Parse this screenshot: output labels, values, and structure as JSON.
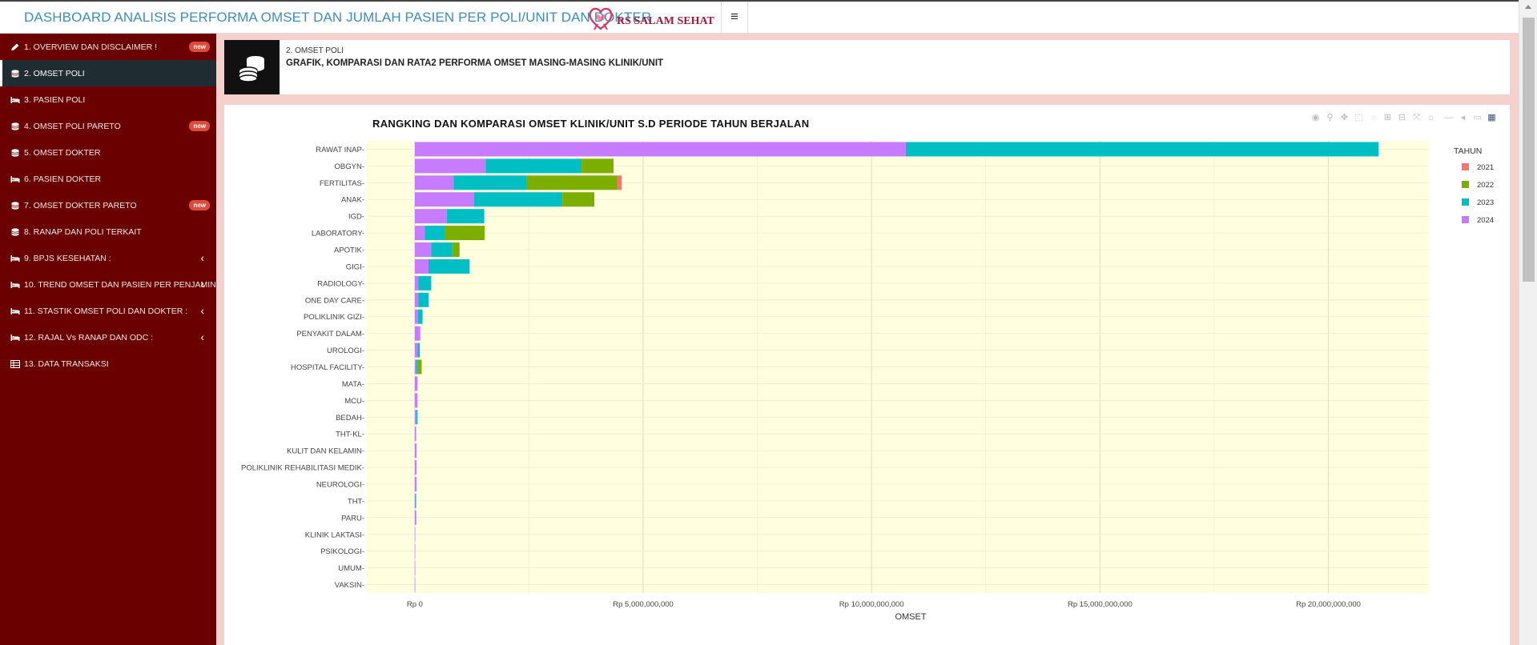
{
  "header": {
    "app_title": "DASHBOARD ANALISIS PERFORMA OMSET DAN JUMLAH PASIEN PER POLI/UNIT DAN DOKTER",
    "logo_text": "RS SALAM SEHAT",
    "menu_icon": "hamburger-icon"
  },
  "sidebar": {
    "items": [
      {
        "label": "1. OVERVIEW DAN DISCLAIMER !",
        "icon": "pencil-icon",
        "badge": "new"
      },
      {
        "label": "2. OMSET POLI",
        "icon": "database-icon",
        "active": true
      },
      {
        "label": "3. PASIEN POLI",
        "icon": "bed-icon"
      },
      {
        "label": "4. OMSET POLI PARETO",
        "icon": "database-icon",
        "badge": "new"
      },
      {
        "label": "5. OMSET DOKTER",
        "icon": "database-icon"
      },
      {
        "label": "6. PASIEN DOKTER",
        "icon": "bed-icon"
      },
      {
        "label": "7. OMSET DOKTER PARETO",
        "icon": "database-icon",
        "badge": "new"
      },
      {
        "label": "8. RANAP DAN POLI TERKAIT",
        "icon": "database-icon"
      },
      {
        "label": "9. BPJS KESEHATAN :",
        "icon": "bed-icon",
        "chevron": true
      },
      {
        "label": "10. TREND OMSET DAN PASIEN PER PENJAMIN :",
        "icon": "bed-icon",
        "chevron": true
      },
      {
        "label": "11. STASTIK OMSET POLI DAN DOKTER :",
        "icon": "bed-icon",
        "chevron": true
      },
      {
        "label": "12. RAJAL Vs RANAP DAN ODC :",
        "icon": "bed-icon",
        "chevron": true
      },
      {
        "label": "13. DATA TRANSAKSI",
        "icon": "table-icon"
      }
    ]
  },
  "page_header": {
    "subtitle": "2. OMSET POLI",
    "title": "GRAFIK, KOMPARASI DAN RATA2 PERFORMA OMSET MASING-MASING KLINIK/UNIT",
    "icon": "database-icon"
  },
  "modebar": [
    "camera-icon",
    "zoom-icon",
    "pan-icon",
    "box-select-icon",
    "lasso-icon",
    "zoom-in-icon",
    "zoom-out-icon",
    "autoscale-icon",
    "reset-axes-icon",
    "spike-lines-icon",
    "hover-closest-icon",
    "hover-compare-icon",
    "plotly-logo-icon"
  ],
  "colors": {
    "2021": "#F8766D",
    "2022": "#7CAE00",
    "2023": "#00BFC4",
    "2024": "#C77CFF",
    "plot_bg": "#FFFFE0",
    "sidebar_bg": "#6B0000"
  },
  "chart_data": {
    "type": "bar",
    "orientation": "horizontal",
    "stacked": true,
    "title": "RANGKING DAN KOMPARASI OMSET KLINIK/UNIT S.D PERIODE TAHUN BERJALAN",
    "xlabel": "OMSET",
    "ylabel": "",
    "xlim": [
      -1050000000,
      22200000000
    ],
    "xticks": [
      {
        "value": 0,
        "label": "Rp 0"
      },
      {
        "value": 5000000000,
        "label": "Rp 5,000,000,000"
      },
      {
        "value": 10000000000,
        "label": "Rp 10,000,000,000"
      },
      {
        "value": 15000000000,
        "label": "Rp 15,000,000,000"
      },
      {
        "value": 20000000000,
        "label": "Rp 20,000,000,000"
      }
    ],
    "legend_title": "TAHUN",
    "legend_position": "right",
    "grid": true,
    "categories": [
      "RAWAT INAP",
      "OBGYN",
      "FERTILITAS",
      "ANAK",
      "IGD",
      "LABORATORY",
      "APOTIK",
      "GIGI",
      "RADIOLOGY",
      "ONE DAY CARE",
      "POLIKLINIK GIZI",
      "PENYAKIT DALAM",
      "UROLOGI",
      "HOSPITAL FACILITY",
      "MATA",
      "MCU",
      "BEDAH",
      "THT-KL",
      "KULIT DAN KELAMIN",
      "POLIKLINIK REHABILITASI MEDIK",
      "NEUROLOGI",
      "THT",
      "PARU",
      "KLINIK LAKTASI",
      "PSIKOLOGI",
      "UMUM",
      "VAKSIN"
    ],
    "series": [
      {
        "name": "2024",
        "values": [
          10750000000,
          1550000000,
          850000000,
          1300000000,
          700000000,
          220000000,
          360000000,
          300000000,
          80000000,
          80000000,
          70000000,
          120000000,
          60000000,
          30000000,
          60000000,
          60000000,
          30000000,
          30000000,
          40000000,
          40000000,
          40000000,
          10000000,
          20000000,
          10000000,
          5000000,
          5000000,
          3000000
        ]
      },
      {
        "name": "2023",
        "values": [
          10350000000,
          2100000000,
          1600000000,
          1930000000,
          820000000,
          430000000,
          460000000,
          900000000,
          280000000,
          220000000,
          100000000,
          0,
          50000000,
          30000000,
          0,
          0,
          30000000,
          0,
          0,
          0,
          0,
          20000000,
          10000000,
          0,
          0,
          0,
          0
        ]
      },
      {
        "name": "2022",
        "values": [
          0,
          700000000,
          1980000000,
          700000000,
          0,
          880000000,
          160000000,
          0,
          0,
          0,
          0,
          0,
          0,
          90000000,
          0,
          0,
          0,
          0,
          0,
          0,
          0,
          0,
          0,
          0,
          0,
          0,
          0
        ]
      },
      {
        "name": "2021",
        "values": [
          0,
          0,
          100000000,
          0,
          0,
          0,
          0,
          0,
          0,
          0,
          0,
          0,
          0,
          0,
          0,
          0,
          0,
          0,
          0,
          0,
          0,
          0,
          0,
          0,
          0,
          0,
          0
        ]
      }
    ],
    "legend_order": [
      "2021",
      "2022",
      "2023",
      "2024"
    ]
  }
}
